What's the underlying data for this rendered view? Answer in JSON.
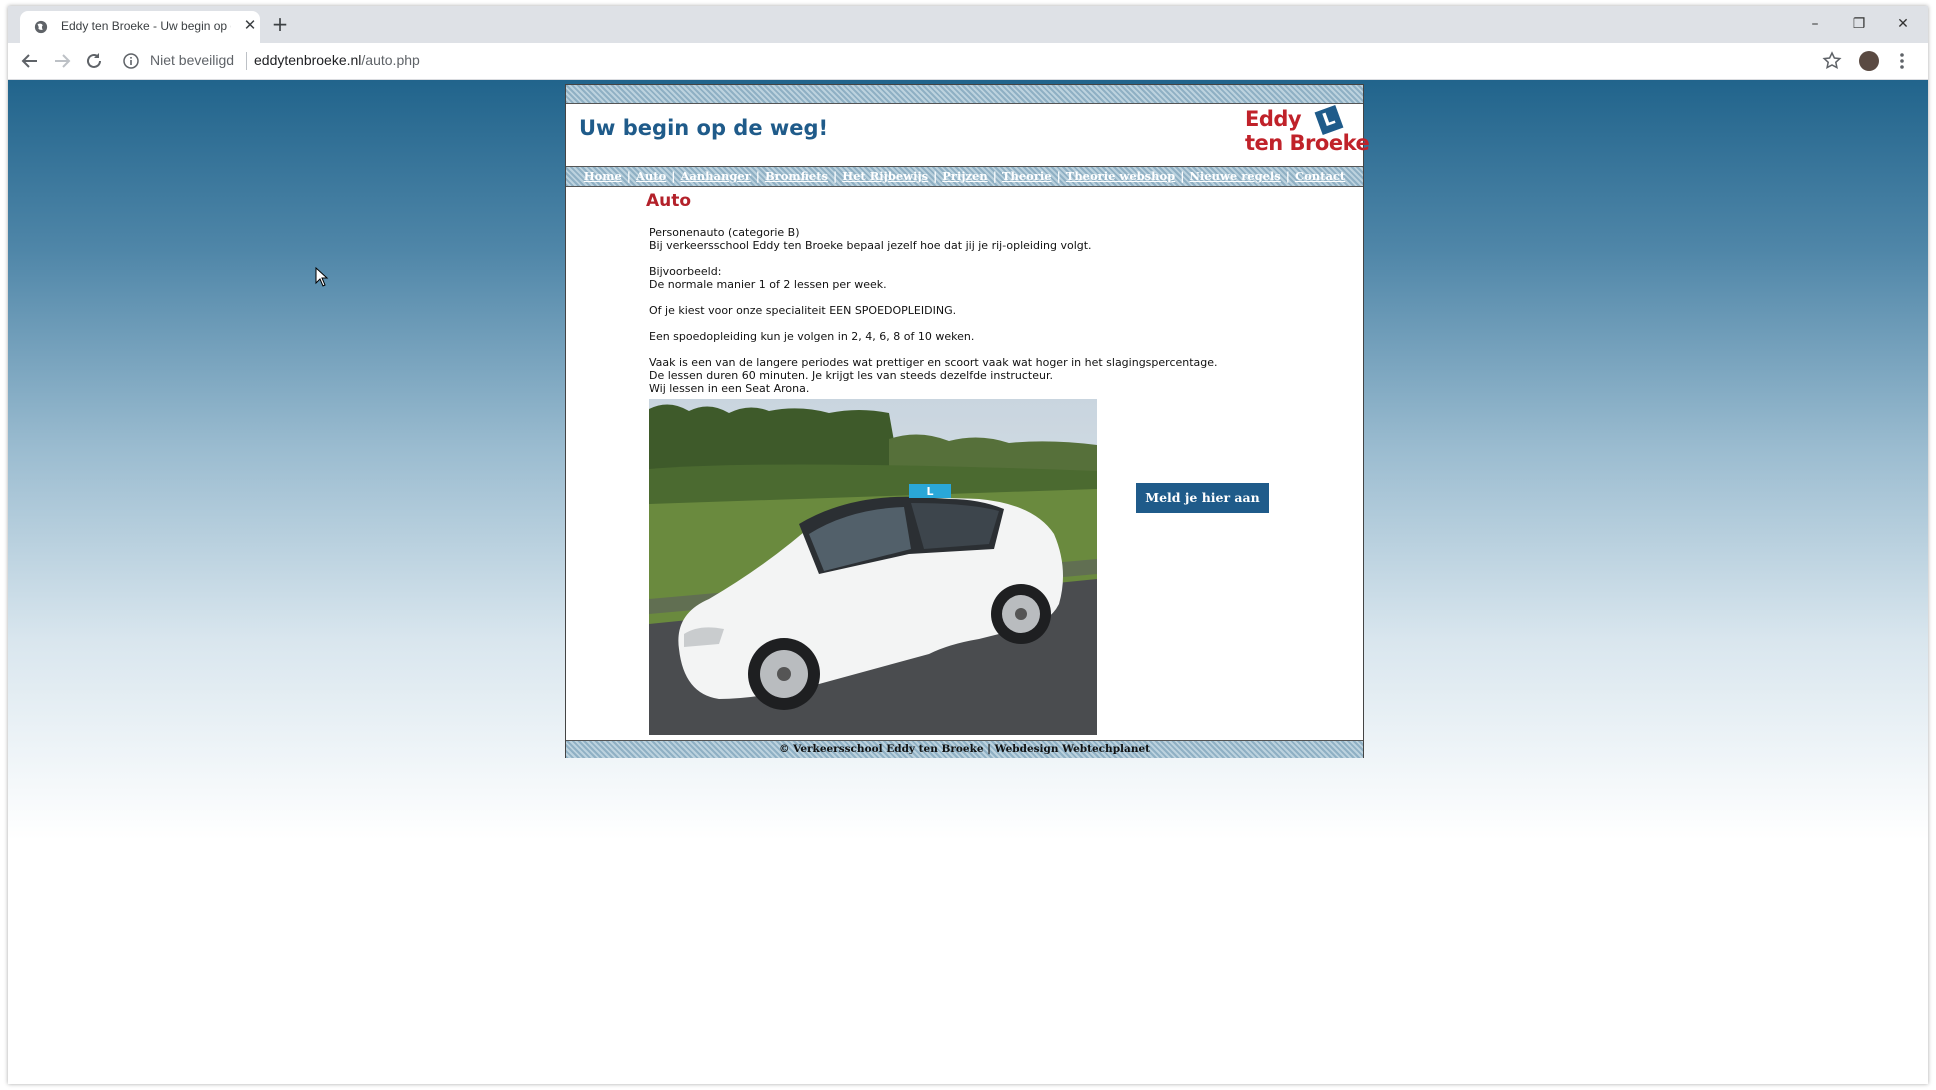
{
  "browser": {
    "tab_title": "Eddy ten Broeke - Uw begin op de weg!",
    "new_tab_label": "+",
    "security_label": "Niet beveiligd",
    "url_host": "eddytenbroeke.nl",
    "url_path": "/auto.php"
  },
  "site": {
    "slogan": "Uw begin op de weg!",
    "logo_line1": "Eddy",
    "logo_line2": "ten Broeke",
    "logo_badge": "L",
    "nav": [
      "Home",
      "Auto",
      "Aanhanger",
      "Bromfiets",
      "Het Rijbewijs",
      "Prijzen",
      "Theorie",
      "Theorie webshop",
      "Nieuwe regels",
      "Contact"
    ],
    "colors": {
      "brand_blue": "#1f5b8a",
      "brand_red": "#b3212a"
    }
  },
  "main": {
    "heading": "Auto",
    "paragraphs": [
      [
        "Personenauto (categorie B)",
        "Bij verkeersschool Eddy ten Broeke bepaal jezelf hoe dat jij je rij-opleiding volgt."
      ],
      [
        "Bijvoorbeeld:",
        "De normale manier 1 of 2 lessen per week."
      ],
      [
        "Of je kiest voor onze specialiteit EEN SPOEDOPLEIDING."
      ],
      [
        "Een spoedopleiding kun je volgen in 2, 4, 6, 8 of 10 weken."
      ],
      [
        "Vaak is een van de langere periodes wat prettiger en scoort vaak wat hoger in het slagingspercentage.",
        "De lessen duren 60 minuten. Je krijgt les van steeds dezelfde instructeur.",
        "Wij lessen in een Seat Arona."
      ]
    ],
    "cta_label": "Meld je hier aan"
  },
  "footer": {
    "text": "© Verkeersschool Eddy ten Broeke | Webdesign Webtechplanet"
  }
}
